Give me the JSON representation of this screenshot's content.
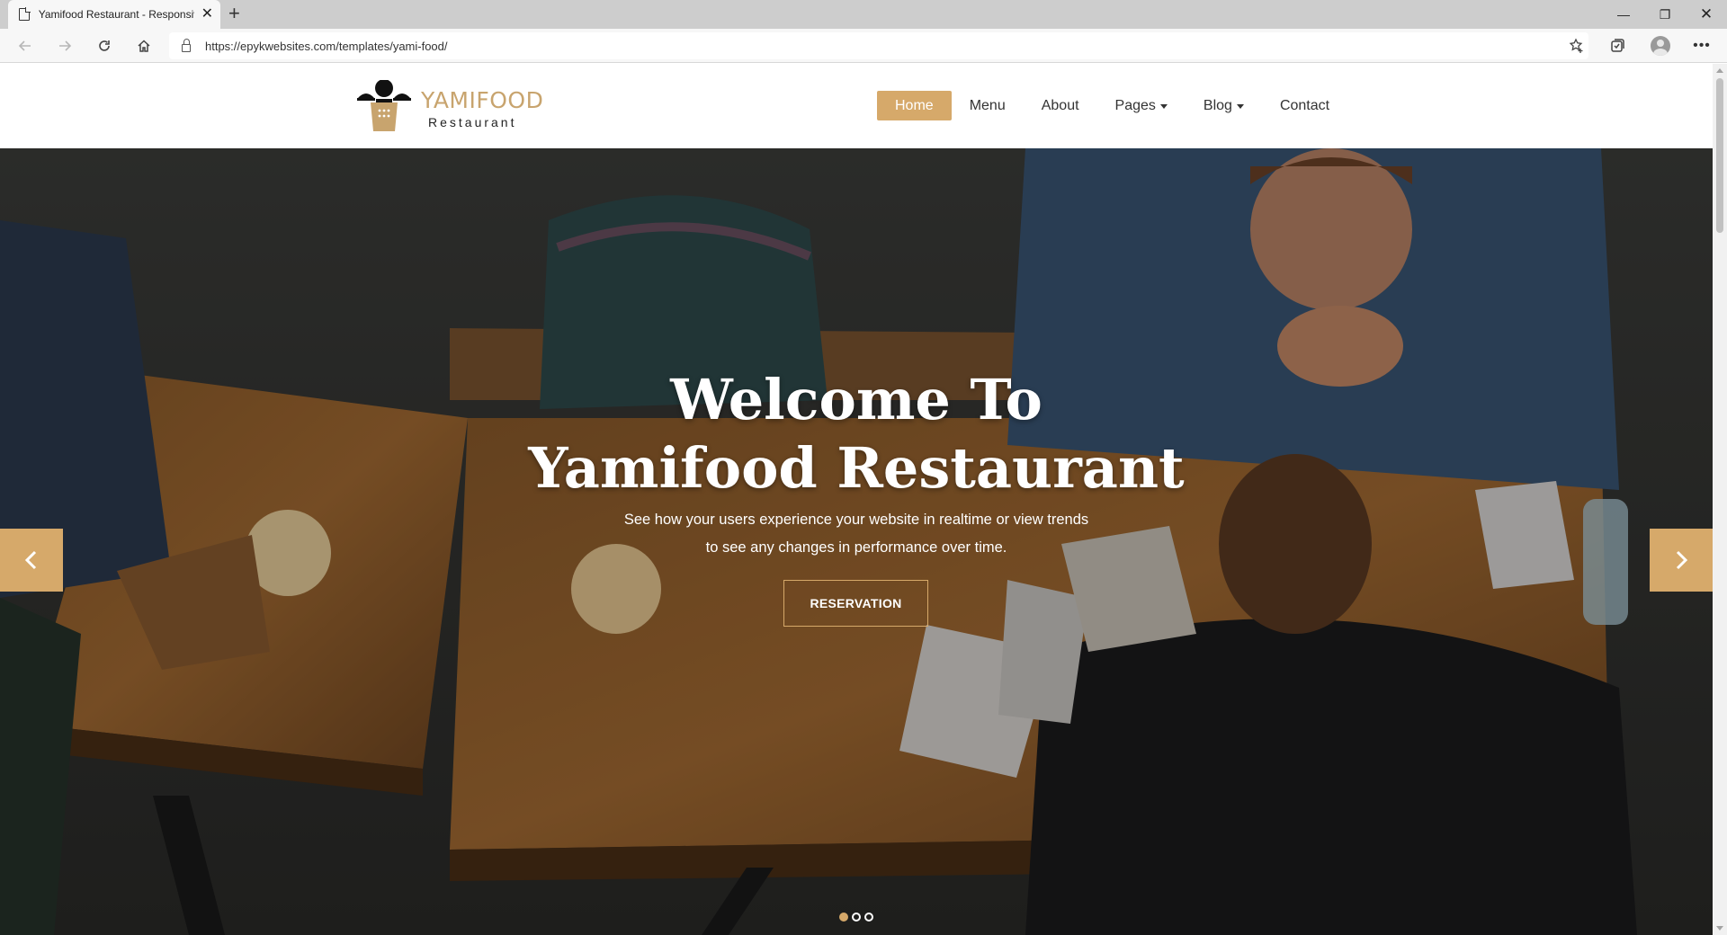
{
  "browser": {
    "tab_title": "Yamifood Restaurant - Responsive",
    "url": "https://epykwebsites.com/templates/yami-food/"
  },
  "site": {
    "logo_name": "YAMIFOOD",
    "logo_sub": "Restaurant",
    "accent_color": "#d6a96a",
    "nav": [
      {
        "label": "Home",
        "active": true
      },
      {
        "label": "Menu"
      },
      {
        "label": "About"
      },
      {
        "label": "Pages",
        "dropdown": true
      },
      {
        "label": "Blog",
        "dropdown": true
      },
      {
        "label": "Contact"
      }
    ]
  },
  "hero": {
    "title_line1": "Welcome To",
    "title_line2": "Yamifood Restaurant",
    "subtitle": "See how your users experience your website in realtime or view trends to see any changes in performance over time.",
    "button": "RESERVATION",
    "slides_total": 3,
    "slide_active": 1
  }
}
